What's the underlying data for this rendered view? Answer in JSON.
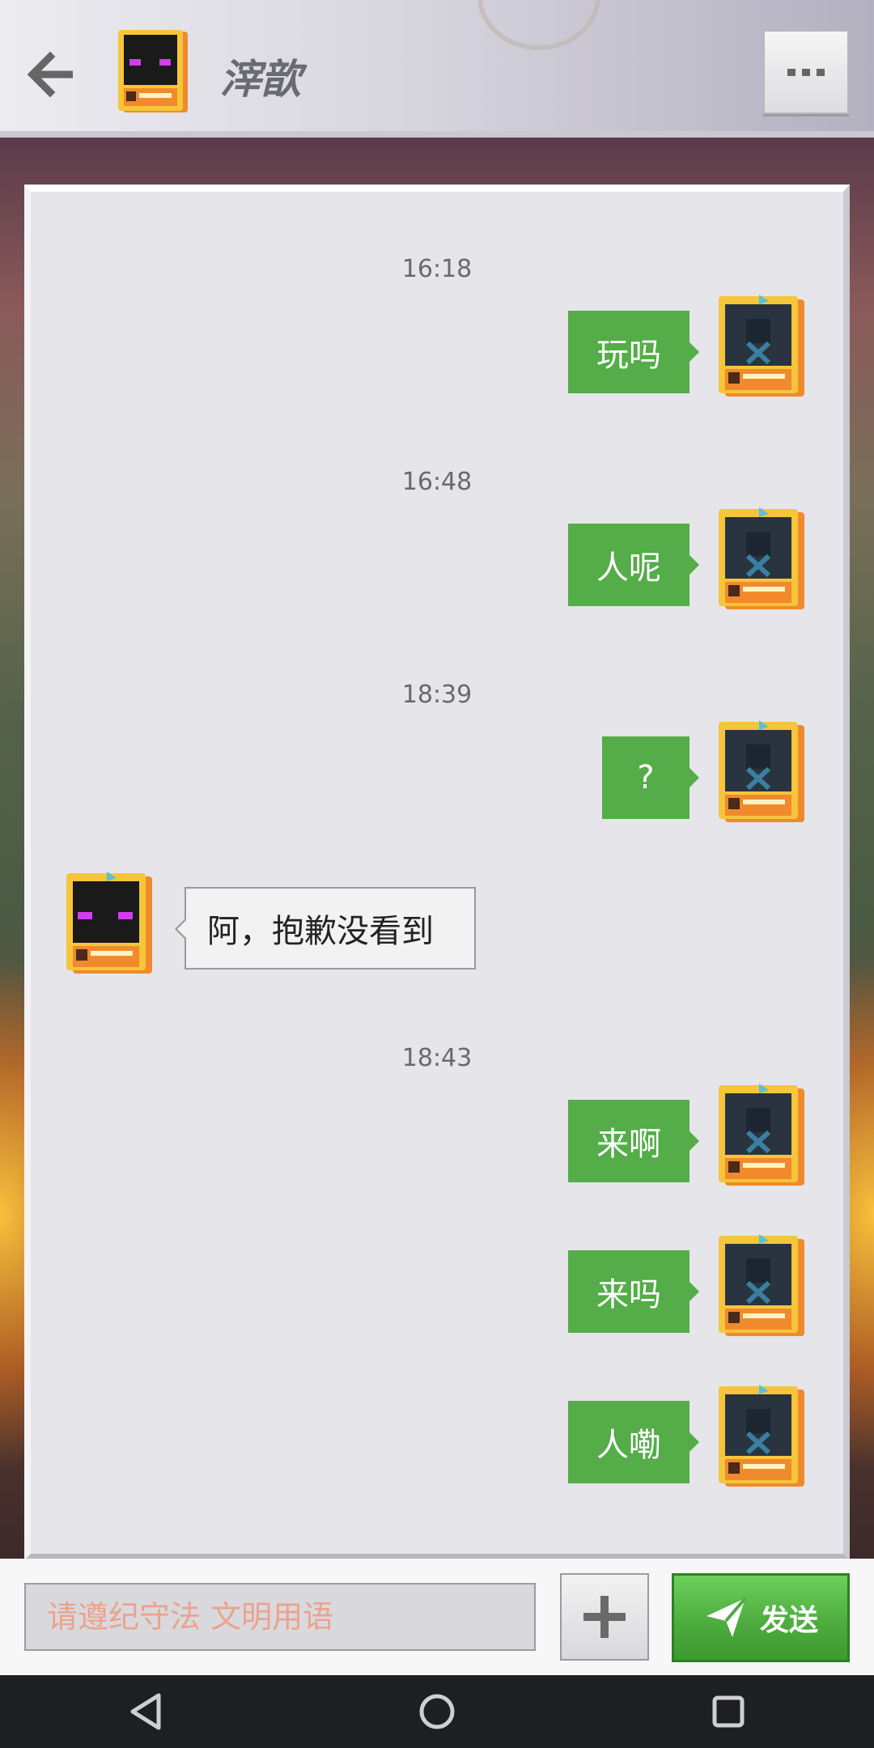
{
  "header": {
    "contact_name": "滓歆",
    "back_icon": "arrow-left-icon",
    "more_icon": "more-horizontal-icon"
  },
  "chat": {
    "timestamps": [
      "16:18",
      "16:48",
      "18:39",
      "18:43"
    ],
    "messages": [
      {
        "from": "me",
        "text": "玩吗"
      },
      {
        "from": "me",
        "text": "人呢"
      },
      {
        "from": "me",
        "text": "?"
      },
      {
        "from": "them",
        "text": "阿，抱歉没看到"
      },
      {
        "from": "me",
        "text": "来啊"
      },
      {
        "from": "me",
        "text": "来吗"
      },
      {
        "from": "me",
        "text": "人嘞"
      }
    ]
  },
  "composer": {
    "placeholder": "请遵纪守法 文明用语",
    "plus_icon": "plus-icon",
    "send_label": "发送",
    "send_icon": "paper-plane-icon"
  },
  "system_nav": {
    "back": "nav-back-icon",
    "home": "nav-home-icon",
    "recents": "nav-recents-icon"
  },
  "colors": {
    "outgoing_bubble": "#54ad48",
    "incoming_bubble": "#f2f2f2",
    "send_button": "#4bab3c",
    "placeholder_text": "#eaa38d"
  }
}
